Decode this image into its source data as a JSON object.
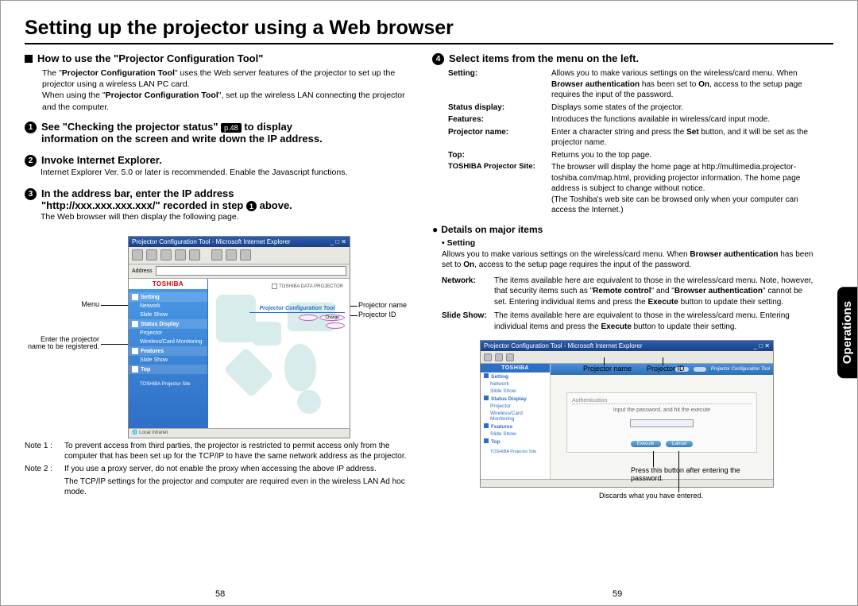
{
  "title": "Setting up the projector using a Web browser",
  "sideTab": "Operations",
  "pageLeft": "58",
  "pageRight": "59",
  "pref48": "p.48",
  "sec1": {
    "head": "How to use the \"Projector Configuration Tool\"",
    "p1a": "The \"",
    "p1b": "Projector Configuration Tool",
    "p1c": "\" uses the Web server features of the projector to set up the projector using a wireless LAN PC card.",
    "p2a": "When using the \"",
    "p2b": "Projector Configuration Tool",
    "p2c": "\", set up the wireless LAN connecting the projector and the computer."
  },
  "step1": {
    "line1a": "See \"Checking the projector status\" ",
    "line1b": " to display",
    "line2": "information on the screen and write down the IP address."
  },
  "step2": {
    "head": "Invoke Internet Explorer.",
    "body": "Internet Explorer Ver. 5.0 or later is recommended. Enable the Javascript functions."
  },
  "step3": {
    "line1": "In the address bar, enter the IP address",
    "line2a": "\"http://xxx.xxx.xxx.xxx/\" recorded in step ",
    "line2b": " above.",
    "body": "The Web browser will then display the following page."
  },
  "labels": {
    "menu": "Menu",
    "enterName": "Enter the projector name to be registered.",
    "projName": "Projector name",
    "projId": "Projector ID",
    "pressBtn": "Press this button after entering the password.",
    "discards": "Discards what you have entered."
  },
  "browser1": {
    "title": "Projector Configuration Tool - Microsoft Internet Explorer",
    "logo": "TOSHIBA",
    "brand": "TOSHIBA DATA PROJECTOR",
    "toolTitle": "Projector Configuration Tool",
    "menu": {
      "setting": "Setting",
      "network": "Network",
      "slideshow": "Slide Show",
      "status": "Status Display",
      "projector": "Projector",
      "wireless": "Wireless/Card Monitoring",
      "features": "Features",
      "slideshow2": "Slide Show",
      "top": "Top",
      "site": "TOSHIBA Projector Site"
    }
  },
  "notes": {
    "n1label": "Note 1 :",
    "n1": "To prevent access from third parties, the projector is restricted to permit access only from the computer that has been set up for the TCP/IP to have the same network address as the projector.",
    "n2label": "Note 2 :",
    "n2": "If you use a proxy server, do not enable the proxy when accessing the above IP address.",
    "n3": "The TCP/IP settings for the projector and computer are required even in the wireless LAN Ad hoc mode."
  },
  "step4": {
    "head": "Select items from the menu on the left.",
    "defs": [
      {
        "lbl": "Setting:",
        "body_a": "Allows you to make various settings on the wireless/card menu. When ",
        "body_b": "Browser authentication",
        "body_c": " has been set to ",
        "body_d": "On",
        "body_e": ", access to the setup page requires the input of the password."
      },
      {
        "lbl": "Status display:",
        "body": "Displays some states of the projector."
      },
      {
        "lbl": "Features:",
        "body": "Introduces the functions available in wireless/card input mode."
      },
      {
        "lbl": "Projector name:",
        "body_a": "Enter a character string and press the ",
        "body_b": "Set",
        "body_c": " button, and it will be set as the projector name."
      },
      {
        "lbl": "Top:",
        "body": "Returns you to the top page."
      },
      {
        "lbl": "TOSHIBA Projector Site:",
        "body": "The browser will display the home page at http://multimedia.projector-toshiba.com/map.html, providing projector information. The home page address is subject to change without notice.",
        "paren": "(The Toshiba's web site can be browsed only when your computer can access the Internet.)"
      }
    ]
  },
  "details": {
    "head": "Details on major items",
    "setting": {
      "lbl": "Setting",
      "body_a": "Allows you to make various settings on the wireless/card menu. When ",
      "body_b": "Browser authentication",
      "body_c": " has been set to ",
      "body_d": "On",
      "body_e": ", access to the setup page requires the input of the password."
    },
    "network": {
      "lbl": "Network:",
      "body_a": "The items available here are equivalent to those in the wireless/card menu. Note, however, that security items such as \"",
      "body_b": "Remote control",
      "body_c": "\" and \"",
      "body_d": "Browser authentication",
      "body_e": "\" cannot be set. Entering individual items and press the ",
      "body_f": "Execute",
      "body_g": " button to update their setting."
    },
    "slideshow": {
      "lbl": "Slide Show:",
      "body_a": "The items available here are equivalent to those in the wireless/card menu. Entering individual items and press the ",
      "body_b": "Execute",
      "body_c": " button to update their setting."
    }
  },
  "browser2": {
    "title": "Projector Configuration Tool - Microsoft Internet Explorer",
    "logo": "TOSHIBA",
    "toolTitle": "Projector Configuration Tool",
    "menu": {
      "setting": "Setting",
      "network": "Network",
      "slideshow": "Slide Show",
      "status": "Status Display",
      "projector": "Projector",
      "wireless": "Wireless/Card Monitoring",
      "features": "Features",
      "slideshow2": "Slide Show",
      "top": "Top",
      "site": "TOSHIBA Projector Site"
    },
    "auth": {
      "title": "Authentication",
      "prompt": "Input the password, and hit the execute",
      "exec": "Execute",
      "cancel": "Cancel"
    }
  }
}
